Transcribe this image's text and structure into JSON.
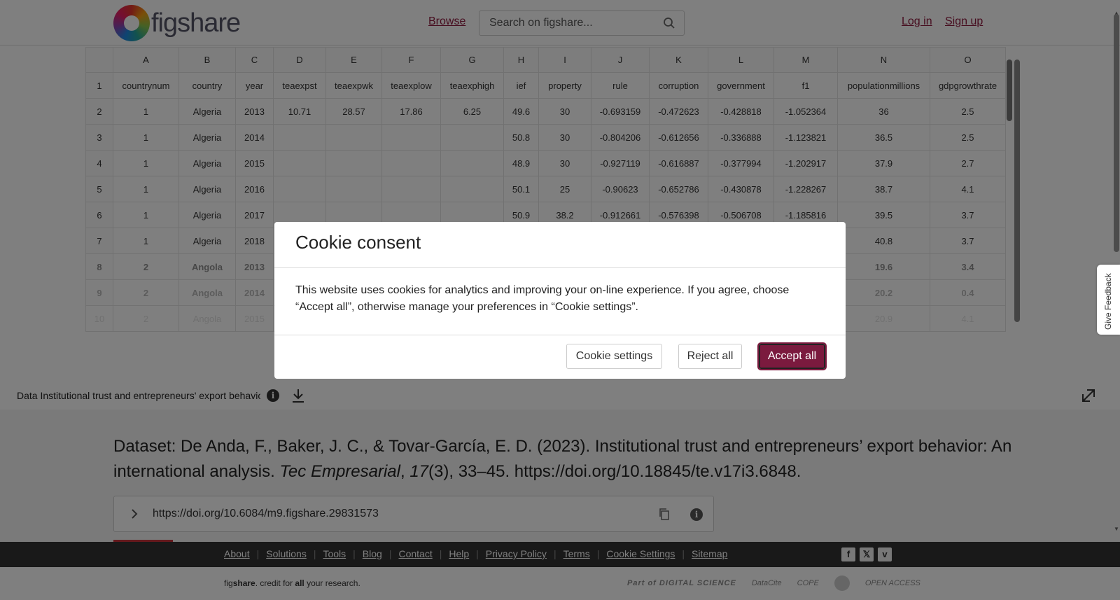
{
  "header": {
    "logo_text": "figshare",
    "browse_label": "Browse",
    "search_placeholder": "Search on figshare...",
    "login_label": "Log in",
    "signup_label": "Sign up"
  },
  "sheet": {
    "columns": [
      "A",
      "B",
      "C",
      "D",
      "E",
      "F",
      "G",
      "H",
      "I",
      "J",
      "K",
      "L",
      "M",
      "N",
      "O"
    ],
    "rows": [
      [
        "1",
        "countrynum",
        "country",
        "year",
        "teaexpst",
        "teaexpwk",
        "teaexplow",
        "teaexphigh",
        "ief",
        "property",
        "rule",
        "corruption",
        "government",
        "f1",
        "populationmillions",
        "gdpgrowthrate"
      ],
      [
        "2",
        "1",
        "Algeria",
        "2013",
        "10.71",
        "28.57",
        "17.86",
        "6.25",
        "49.6",
        "30",
        "-0.693159",
        "-0.472623",
        "-0.428818",
        "-1.052364",
        "36",
        "2.5"
      ],
      [
        "3",
        "1",
        "Algeria",
        "2014",
        "",
        "",
        "",
        "",
        "50.8",
        "30",
        "-0.804206",
        "-0.612656",
        "-0.336888",
        "-1.123821",
        "36.5",
        "2.5"
      ],
      [
        "4",
        "1",
        "Algeria",
        "2015",
        "",
        "",
        "",
        "",
        "48.9",
        "30",
        "-0.927119",
        "-0.616887",
        "-0.377994",
        "-1.202917",
        "37.9",
        "2.7"
      ],
      [
        "5",
        "1",
        "Algeria",
        "2016",
        "",
        "",
        "",
        "",
        "50.1",
        "25",
        "-0.90623",
        "-0.652786",
        "-0.430878",
        "-1.228267",
        "38.7",
        "4.1"
      ],
      [
        "6",
        "1",
        "Algeria",
        "2017",
        "",
        "",
        "",
        "",
        "50.9",
        "38.2",
        "-0.912661",
        "-0.576398",
        "-0.506708",
        "-1.185816",
        "39.5",
        "3.7"
      ],
      [
        "7",
        "1",
        "Algeria",
        "2018",
        "",
        "",
        "",
        "",
        "",
        "",
        "",
        "",
        "",
        "",
        "40.8",
        "3.7"
      ],
      [
        "8",
        "2",
        "Angola",
        "2013",
        "",
        "",
        "",
        "",
        "",
        "",
        "",
        "",
        "",
        "",
        "19.6",
        "3.4"
      ],
      [
        "9",
        "2",
        "Angola",
        "2014",
        "",
        "",
        "",
        "",
        "",
        "",
        "",
        "",
        "",
        "",
        "20.2",
        "0.4"
      ],
      [
        "10",
        "2",
        "Angola",
        "2015",
        "",
        "",
        "",
        "",
        "",
        "",
        "",
        "",
        "",
        "",
        "20.9",
        "4.1"
      ]
    ]
  },
  "file_bar": {
    "file_name": "Data Institutional trust and entrepreneurs' export behavior",
    "info_icon": "i"
  },
  "citation": {
    "prefix": "Dataset: De Anda, F., Baker, J. C., & Tovar-García, E. D. (2023). Institutional trust and entrepreneurs’ export behavior: An international analysis. ",
    "journal": "Tec Empresarial",
    "sep": ", ",
    "volume": "17",
    "suffix": "(3), 33–45. https://doi.org/10.18845/te.v17i3.6848."
  },
  "doi": {
    "url": "https://doi.org/10.6084/m9.figshare.29831573",
    "info_icon": "i"
  },
  "feedback_label": "Give Feedback",
  "footer": {
    "links": [
      "About",
      "Solutions",
      "Tools",
      "Blog",
      "Contact",
      "Help",
      "Privacy Policy",
      "Terms",
      "Cookie Settings",
      "Sitemap"
    ],
    "social": [
      "f",
      "𝕏",
      "v"
    ]
  },
  "bottom": {
    "tag_pre": "fig",
    "tag_brand": "share",
    "tag_mid": ". credit for ",
    "tag_all": "all",
    "tag_end": " your research.",
    "partners": [
      "Part of DIGITAL SCIENCE",
      "DataCite",
      "COPE",
      "OPEN ACCESS"
    ]
  },
  "cookie_modal": {
    "title": "Cookie consent",
    "body": "This website uses cookies for analytics and improving your on-line experience. If you agree, choose “Accept all”, otherwise manage your preferences in “Cookie settings”.",
    "settings_label": "Cookie settings",
    "reject_label": "Reject all",
    "accept_label": "Accept all"
  },
  "colors": {
    "brand": "#8e1a3f",
    "accept_button": "#7b1a3e",
    "footer_bg": "#333333"
  }
}
